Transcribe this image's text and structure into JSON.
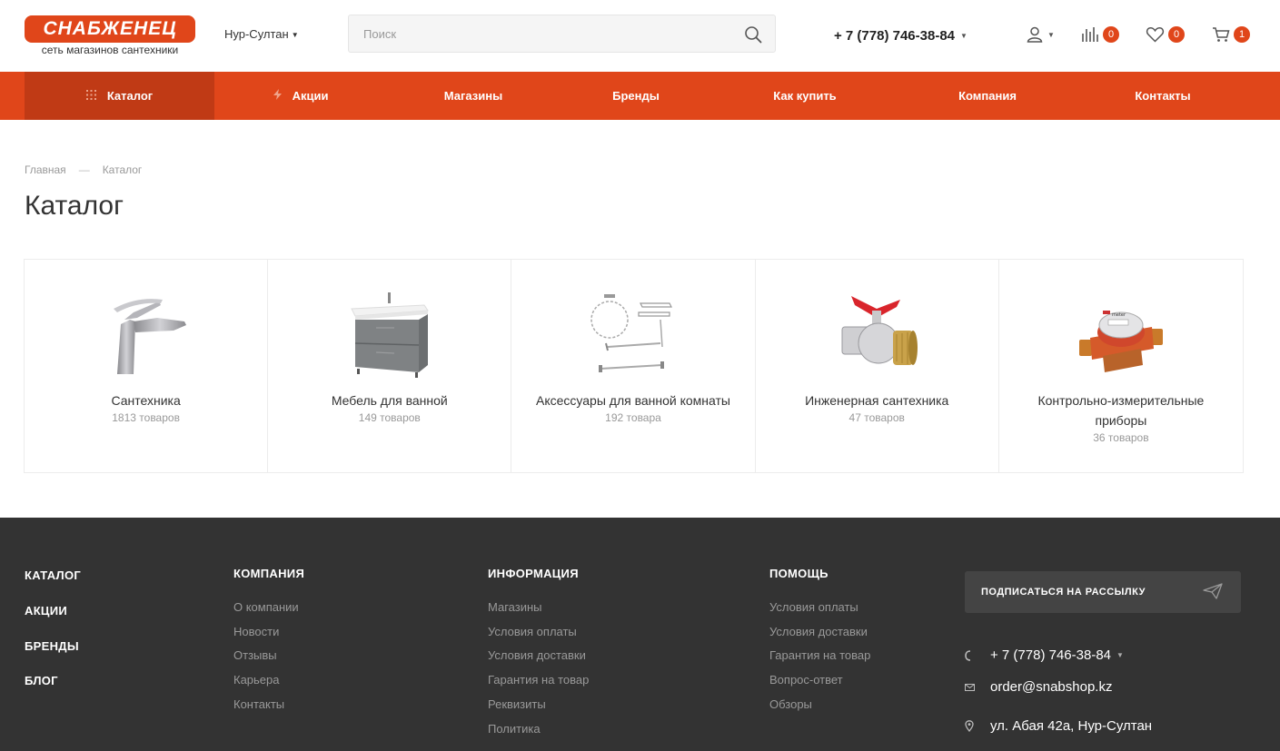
{
  "header": {
    "logo_text": "СНАБЖЕНЕЦ",
    "logo_tagline": "сеть магазинов сантехники",
    "city": "Нур-Султан",
    "search_placeholder": "Поиск",
    "phone": "+ 7 (778) 746-38-84",
    "compare_count": "0",
    "favorites_count": "0",
    "cart_count": "1"
  },
  "nav": {
    "items": [
      {
        "label": "Каталог",
        "icon": "grid-icon"
      },
      {
        "label": "Акции",
        "icon": "lightning-icon"
      },
      {
        "label": "Магазины"
      },
      {
        "label": "Бренды"
      },
      {
        "label": "Как купить"
      },
      {
        "label": "Компания"
      },
      {
        "label": "Контакты"
      }
    ]
  },
  "breadcrumb": {
    "home": "Главная",
    "separator": "—",
    "current": "Каталог"
  },
  "page_title": "Каталог",
  "categories": [
    {
      "name": "Сантехника",
      "count": "1813 товаров",
      "icon": "faucet-image"
    },
    {
      "name": "Мебель для ванной",
      "count": "149 товаров",
      "icon": "vanity-cabinet-image"
    },
    {
      "name": "Аксессуары для ванной комнаты",
      "count": "192 товара",
      "icon": "bathroom-accessories-image"
    },
    {
      "name": "Инженерная сантехника",
      "count": "47 товаров",
      "icon": "ball-valve-image"
    },
    {
      "name": "Контрольно-измерительные приборы",
      "count": "36 товаров",
      "icon": "water-meter-image"
    }
  ],
  "footer": {
    "main_links": [
      "КАТАЛОГ",
      "АКЦИИ",
      "БРЕНДЫ",
      "БЛОГ"
    ],
    "company": {
      "title": "КОМПАНИЯ",
      "links": [
        "О компании",
        "Новости",
        "Отзывы",
        "Карьера",
        "Контакты"
      ]
    },
    "info": {
      "title": "ИНФОРМАЦИЯ",
      "links": [
        "Магазины",
        "Условия оплаты",
        "Условия доставки",
        "Гарантия на товар",
        "Реквизиты",
        "Политика"
      ]
    },
    "help": {
      "title": "ПОМОЩЬ",
      "links": [
        "Условия оплаты",
        "Условия доставки",
        "Гарантия на товар",
        "Вопрос-ответ",
        "Обзоры"
      ]
    },
    "subscribe_label": "ПОДПИСАТЬСЯ НА РАССЫЛКУ",
    "phone": "+ 7 (778) 746-38-84",
    "email": "order@snabshop.kz",
    "address": "ул. Абая 42а, Нур-Султан"
  },
  "colors": {
    "accent": "#e0461a",
    "accent_dark": "#c03a15",
    "footer_bg": "#333333"
  }
}
